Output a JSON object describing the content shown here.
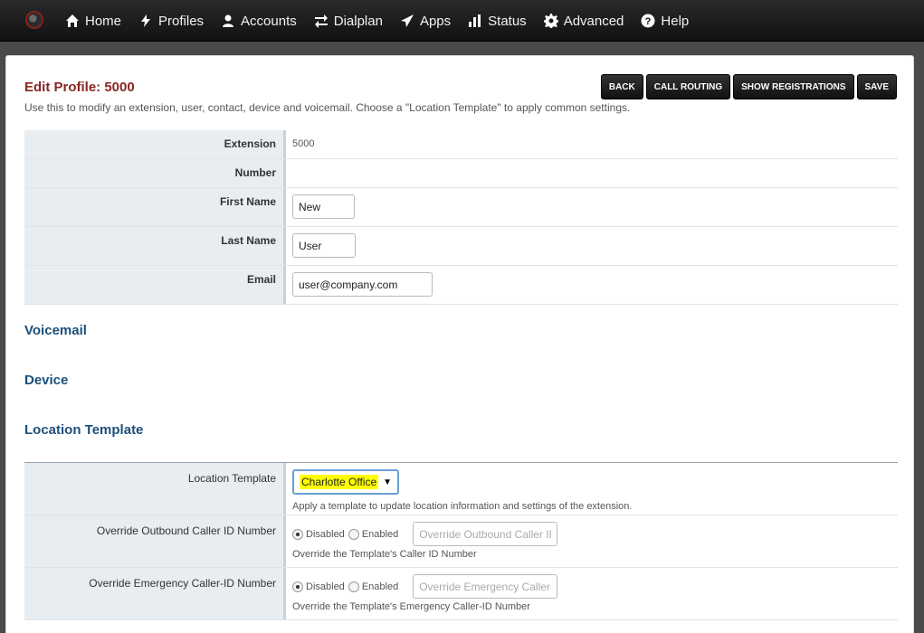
{
  "nav": {
    "items": [
      {
        "label": "Home",
        "icon": "home-icon"
      },
      {
        "label": "Profiles",
        "icon": "bolt-icon"
      },
      {
        "label": "Accounts",
        "icon": "user-icon"
      },
      {
        "label": "Dialplan",
        "icon": "arrows-icon"
      },
      {
        "label": "Apps",
        "icon": "paper-plane-icon"
      },
      {
        "label": "Status",
        "icon": "bar-chart-icon"
      },
      {
        "label": "Advanced",
        "icon": "gear-icon"
      },
      {
        "label": "Help",
        "icon": "question-icon"
      }
    ]
  },
  "page": {
    "title": "Edit Profile: 5000",
    "description": "Use this to modify an extension, user, contact, device and voicemail. Choose a \"Location Template\" to apply common settings."
  },
  "actions": {
    "back": "BACK",
    "call_routing": "CALL ROUTING",
    "show_registrations": "SHOW REGISTRATIONS",
    "save": "SAVE"
  },
  "profile": {
    "extension_label": "Extension",
    "extension_value": "5000",
    "number_label": "Number",
    "first_name_label": "First Name",
    "first_name_value": "New",
    "last_name_label": "Last Name",
    "last_name_value": "User",
    "email_label": "Email",
    "email_value": "user@company.com"
  },
  "sections": {
    "voicemail": "Voicemail",
    "device": "Device",
    "location_template": "Location Template"
  },
  "location": {
    "template_label": "Location Template",
    "template_selected": "Charlotte Office",
    "template_help": "Apply a template to update location information and settings of the extension.",
    "outbound_label": "Override Outbound Caller ID Number",
    "outbound_disabled": "Disabled",
    "outbound_enabled": "Enabled",
    "outbound_placeholder": "Override Outbound Caller ID Number",
    "outbound_help": "Override the Template's Caller ID Number",
    "emergency_label": "Override Emergency Caller-ID Number",
    "emergency_disabled": "Disabled",
    "emergency_enabled": "Enabled",
    "emergency_placeholder": "Override Emergency Caller-ID Number",
    "emergency_help": "Override the Template's Emergency Caller-ID Number"
  },
  "colors": {
    "title": "#8b2525",
    "section": "#1d4f7a",
    "highlight": "#ffff00"
  }
}
